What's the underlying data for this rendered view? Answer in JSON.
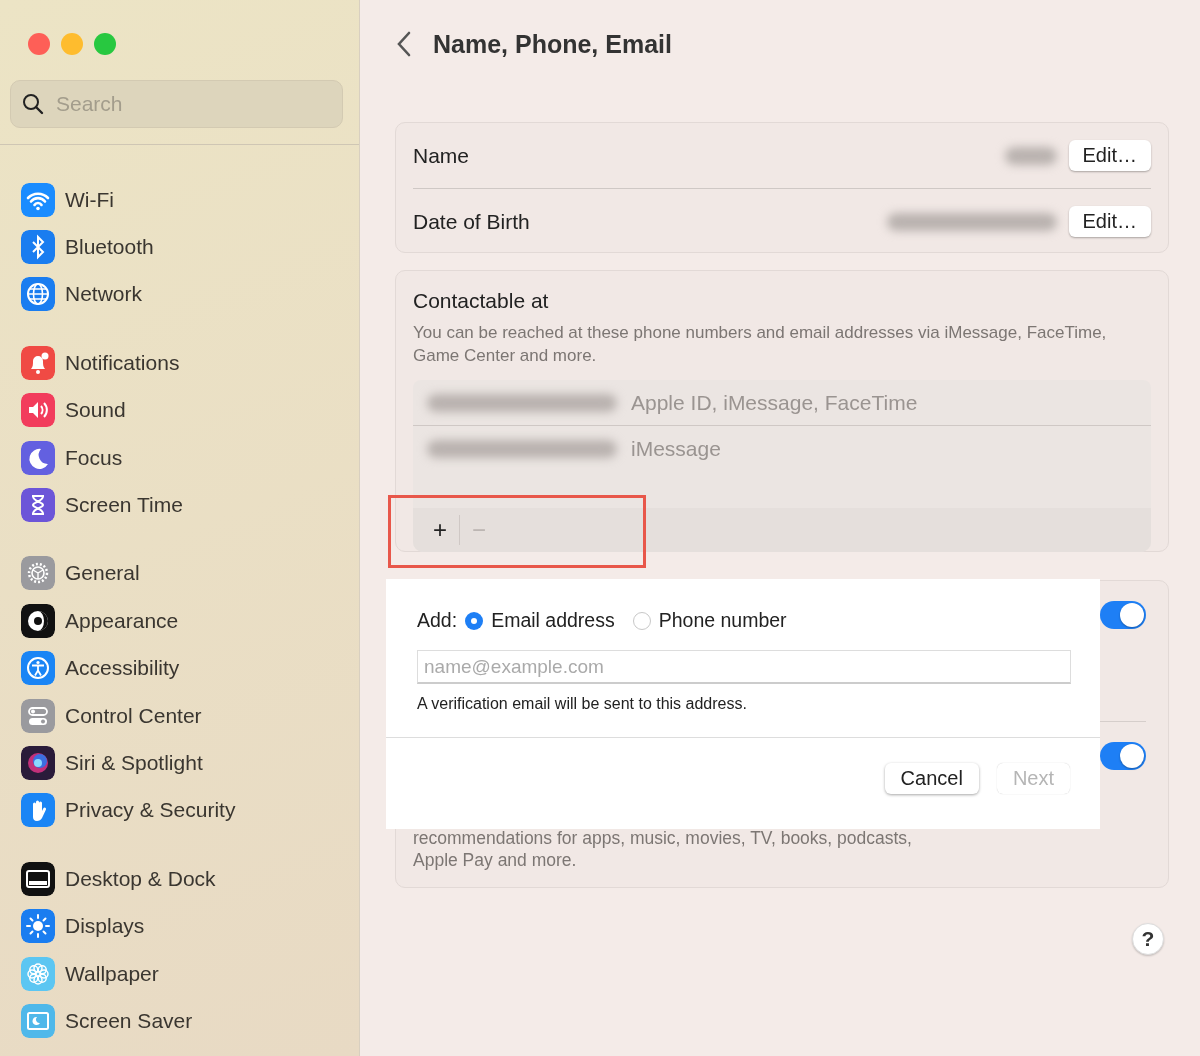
{
  "window": {
    "title": "Name, Phone, Email"
  },
  "sidebar": {
    "search": {
      "placeholder": "Search"
    },
    "groups": [
      {
        "items": [
          {
            "label": "Wi-Fi"
          },
          {
            "label": "Bluetooth"
          },
          {
            "label": "Network"
          }
        ]
      },
      {
        "items": [
          {
            "label": "Notifications"
          },
          {
            "label": "Sound"
          },
          {
            "label": "Focus"
          },
          {
            "label": "Screen Time"
          }
        ]
      },
      {
        "items": [
          {
            "label": "General"
          },
          {
            "label": "Appearance"
          },
          {
            "label": "Accessibility"
          },
          {
            "label": "Control Center"
          },
          {
            "label": "Siri & Spotlight"
          },
          {
            "label": "Privacy & Security"
          }
        ]
      },
      {
        "items": [
          {
            "label": "Desktop & Dock"
          },
          {
            "label": "Displays"
          },
          {
            "label": "Wallpaper"
          },
          {
            "label": "Screen Saver"
          }
        ]
      }
    ]
  },
  "personal": {
    "rows": [
      {
        "label": "Name",
        "button": "Edit…"
      },
      {
        "label": "Date of Birth",
        "button": "Edit…"
      }
    ]
  },
  "contactable": {
    "title": "Contactable at",
    "description": "You can be reached at these phone numbers and email addresses via iMessage, FaceTime, Game Center and more.",
    "entries": [
      {
        "services": "Apple ID, iMessage, FaceTime"
      },
      {
        "services": "iMessage"
      }
    ],
    "add_button": "+",
    "remove_button": {
      "label": "−",
      "disabled": true
    }
  },
  "settings_card": {
    "toggles": [
      {
        "on": true
      },
      {
        "on": true
      }
    ],
    "description_lines": [
      "recommendations for apps, music, movies, TV, books, podcasts,",
      "Apple Pay and more."
    ]
  },
  "add_dialog": {
    "label": "Add:",
    "options": [
      {
        "label": "Email address",
        "selected": true
      },
      {
        "label": "Phone number",
        "selected": false
      }
    ],
    "field": {
      "placeholder": "name@example.com"
    },
    "note": "A verification email will be sent to this address.",
    "buttons": [
      {
        "label": "Cancel",
        "disabled": false
      },
      {
        "label": "Next",
        "disabled": true
      }
    ]
  },
  "help_button": "?"
}
